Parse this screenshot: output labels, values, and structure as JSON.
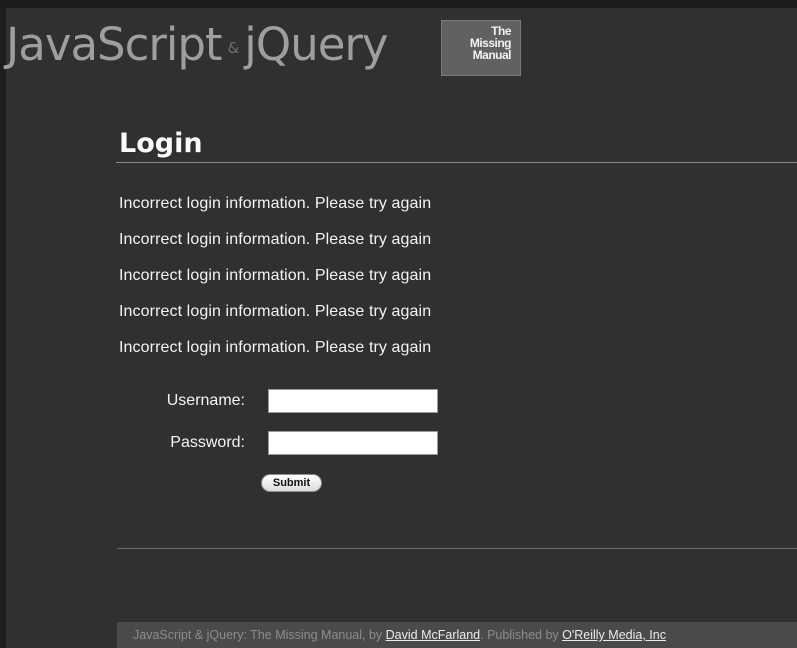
{
  "banner": {
    "title_left": "JavaScript",
    "ampersand": "&",
    "title_right": "jQuery",
    "logo_line1": "The",
    "logo_line2": "Missing",
    "logo_line3": "Manual"
  },
  "login": {
    "heading": "Login",
    "messages": [
      "Incorrect login information. Please try again",
      "Incorrect login information. Please try again",
      "Incorrect login information. Please try again",
      "Incorrect login information. Please try again",
      "Incorrect login information. Please try again"
    ],
    "username_label": "Username:",
    "username_value": "",
    "password_label": "Password:",
    "password_value": "",
    "submit_label": "Submit"
  },
  "footer": {
    "text_prefix": "JavaScript & jQuery: The Missing Manual, by ",
    "author_link": "David McFarland",
    "text_middle": ". Published by ",
    "publisher_link": "O'Reilly Media, Inc"
  }
}
